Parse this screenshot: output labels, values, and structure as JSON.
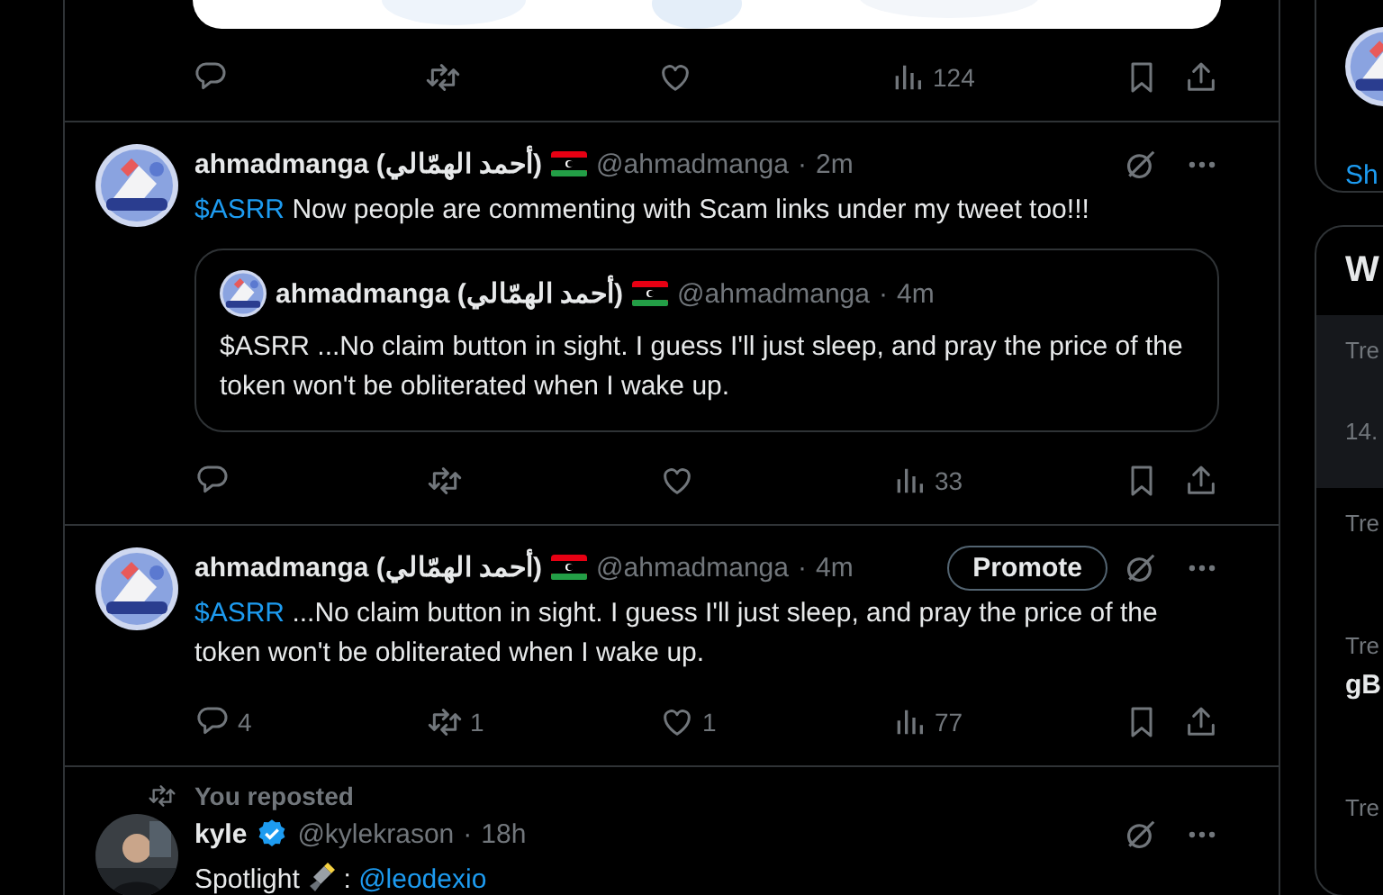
{
  "previous_post": {
    "actions": [
      {
        "kind": "reply"
      },
      {
        "kind": "repost"
      },
      {
        "kind": "like"
      },
      {
        "kind": "views",
        "count": "124"
      }
    ]
  },
  "posts": [
    {
      "name": "ahmadmanga (أحمد الهمّالي)",
      "flag": true,
      "verified": false,
      "handle": "@ahmadmanga",
      "dot": "·",
      "time": "2m",
      "ticker": "$ASRR",
      "text": "Now people are commenting with Scam links under my tweet too!!!",
      "quote": {
        "name": "ahmadmanga (أحمد الهمّالي)",
        "flag": true,
        "handle": "@ahmadmanga",
        "dot": "·",
        "time": "4m",
        "text": "$ASRR ...No claim button in sight. I guess I'll just sleep, and pray the price of the token won't be obliterated when I wake up."
      },
      "actions": [
        {
          "kind": "reply"
        },
        {
          "kind": "repost"
        },
        {
          "kind": "like"
        },
        {
          "kind": "views",
          "count": "33"
        }
      ]
    },
    {
      "name": "ahmadmanga (أحمد الهمّالي)",
      "flag": true,
      "verified": false,
      "handle": "@ahmadmanga",
      "dot": "·",
      "time": "4m",
      "promote": "Promote",
      "ticker": "$ASRR",
      "text": "...No claim button in sight. I guess I'll just sleep, and pray the price of the token won't be obliterated when I wake up.",
      "actions": [
        {
          "kind": "reply",
          "count": "4"
        },
        {
          "kind": "repost",
          "count": "1"
        },
        {
          "kind": "like",
          "count": "1"
        },
        {
          "kind": "views",
          "count": "77"
        }
      ]
    },
    {
      "reposted_by": "You reposted",
      "name": "kyle",
      "flag": false,
      "verified": true,
      "handle": "@kylekrason",
      "dot": "·",
      "time": "18h",
      "text": "Spotlight",
      "separator": ":",
      "mention": "@leodexio"
    }
  ],
  "sidebar": {
    "card_1": {
      "link": "Sh"
    },
    "card_2": {
      "title": "W",
      "rows": [
        {
          "highlighted": true,
          "lines": [
            {
              "kind": "label",
              "text": "Tre"
            },
            {
              "kind": "count",
              "text": "14."
            }
          ]
        },
        {
          "highlighted": false,
          "lines": [
            {
              "kind": "label",
              "text": "Tre"
            }
          ]
        },
        {
          "highlighted": false,
          "lines": [
            {
              "kind": "label",
              "text": "Tre"
            },
            {
              "kind": "topic",
              "text": "gB"
            }
          ]
        },
        {
          "highlighted": false,
          "lines": [
            {
              "kind": "label",
              "text": "Tre"
            }
          ]
        }
      ]
    }
  }
}
